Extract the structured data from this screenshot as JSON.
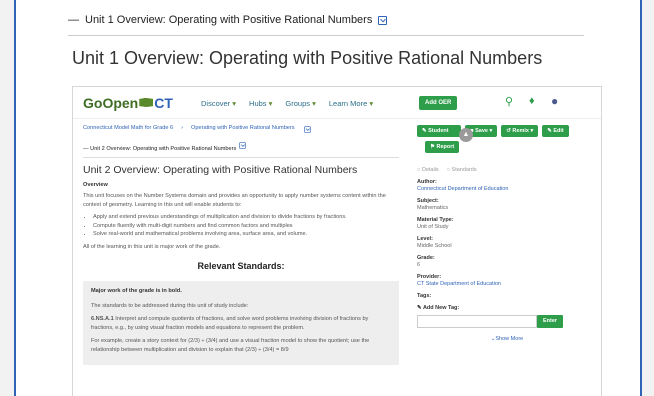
{
  "outer": {
    "breadcrumb_label": "Unit 1 Overview: Operating with Positive Rational Numbers",
    "title": "Unit 1 Overview: Operating with Positive Rational Numbers"
  },
  "nav": {
    "logo_go": "GoOpen",
    "logo_ct": "CT",
    "menu": [
      "Discover",
      "Hubs",
      "Groups",
      "Learn More"
    ],
    "add_oer": "Add OER"
  },
  "content": {
    "breadcrumb": [
      "Connecticut Model Math for Grade 6",
      "Operating with Positive Rational Numbers"
    ],
    "sub_breadcrumb": "Unit 2 Overview: Operating with Positive Rational Numbers",
    "heading": "Unit 2 Overview: Operating with Positive Rational Numbers",
    "overview_label": "Overview",
    "overview_text": "This unit focuses on the Number Systems domain and provides an opportunity to apply number systems content within the context of geometry.  Learning in this unit will enable students to:",
    "bullets": [
      "Apply and extend previous understandings of multiplication and division to divide fractions by fractions.",
      "Compute fluently with multi-digit numbers and find common factors and multiples",
      "Solve real-world and mathematical problems involving area, surface area, and volume."
    ],
    "major_work": "All of the learning in this unit is major work of the grade.",
    "relevant_standards": "Relevant Standards:",
    "box_bold": "Major work of the grade is in bold.",
    "box_intro": "The standards to be addressed during this unit of study include:",
    "box_std_code": "6.NS.A.1",
    "box_std_text": " Interpret and compute quotients of fractions, and solve word problems involving division of fractions by fractions, e.g., by using visual fraction models and equations to represent the problem.",
    "box_example": "For example, create a story context for (2/3) ÷ (3/4) and use a visual fraction model to show the quotient; use the relationship between multiplication and division to explain that (2/3) ÷ (3/4) = 8/9"
  },
  "sidebar": {
    "buttons": [
      "Student",
      "Save",
      "Remix",
      "Edit",
      "Report"
    ],
    "tabs": [
      "Details",
      "Standards"
    ],
    "fields": [
      {
        "key": "Author:",
        "value": "Connecticut Department of Education",
        "link": true
      },
      {
        "key": "Subject:",
        "value": "Mathematics",
        "link": false
      },
      {
        "key": "Material Type:",
        "value": "Unit of Study",
        "link": false
      },
      {
        "key": "Level:",
        "value": "Middle School",
        "link": false
      },
      {
        "key": "Grade:",
        "value": "6",
        "link": false
      },
      {
        "key": "Provider:",
        "value": "CT State Department of Education",
        "link": true
      },
      {
        "key": "Tags:",
        "value": "",
        "link": false
      }
    ],
    "add_tag_label": "Add New Tag:",
    "enter": "Enter",
    "show_more": "Show More"
  },
  "colors": {
    "accent_green": "#2f9e4a",
    "link_blue": "#2f63b7",
    "frame_blue": "#2f63b7"
  }
}
